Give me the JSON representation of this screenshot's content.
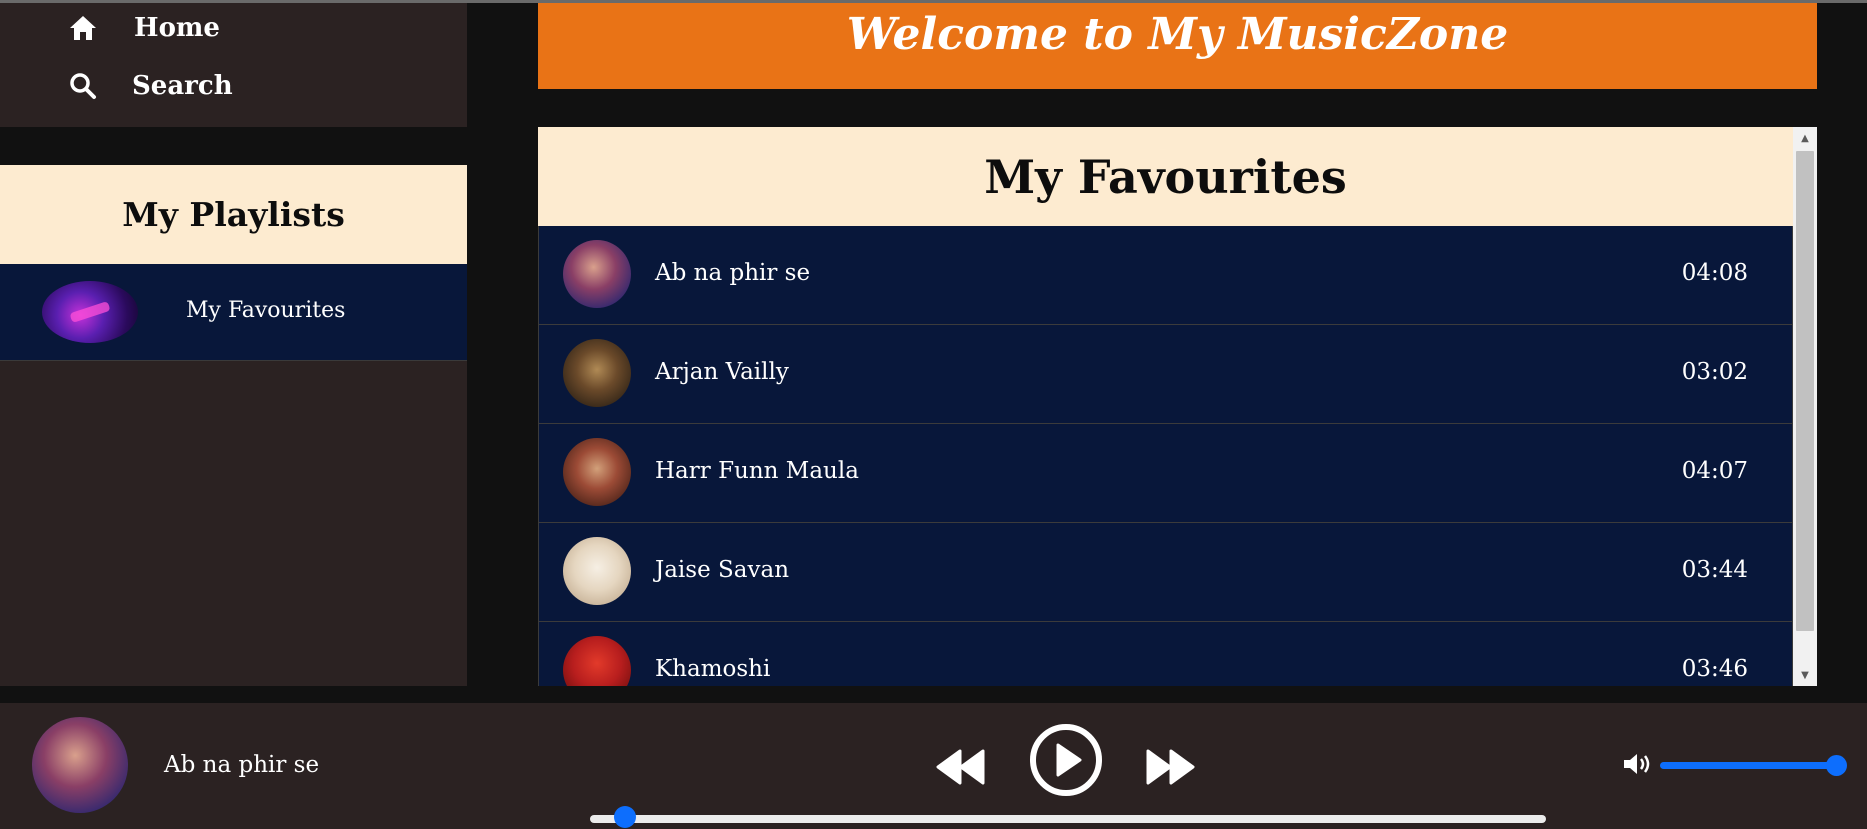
{
  "nav": {
    "items": [
      {
        "label": "Home",
        "icon": "home-icon"
      },
      {
        "label": "Search",
        "icon": "search-icon"
      }
    ]
  },
  "playlists": {
    "title": "My Playlists",
    "items": [
      {
        "name": "My Favourites"
      }
    ]
  },
  "main": {
    "welcome": "Welcome to My MusicZone",
    "favourites_title": "My Favourites",
    "songs": [
      {
        "title": "Ab na phir se",
        "duration": "04:08"
      },
      {
        "title": "Arjan Vailly",
        "duration": "03:02"
      },
      {
        "title": "Harr Funn Maula",
        "duration": "04:07"
      },
      {
        "title": "Jaise Savan",
        "duration": "03:44"
      },
      {
        "title": "Khamoshi",
        "duration": "03:46"
      }
    ]
  },
  "player": {
    "now_playing": "Ab na phir se",
    "progress_fraction": 0.03,
    "volume_fraction": 1.0,
    "controls": [
      "rewind-icon",
      "play-icon",
      "fast-forward-icon"
    ]
  },
  "colors": {
    "accent_orange": "#e97316",
    "panel_dark": "#2b2222",
    "row_navy": "#08173a",
    "header_cream": "#fdebd0",
    "slider_blue": "#0d6efd"
  }
}
